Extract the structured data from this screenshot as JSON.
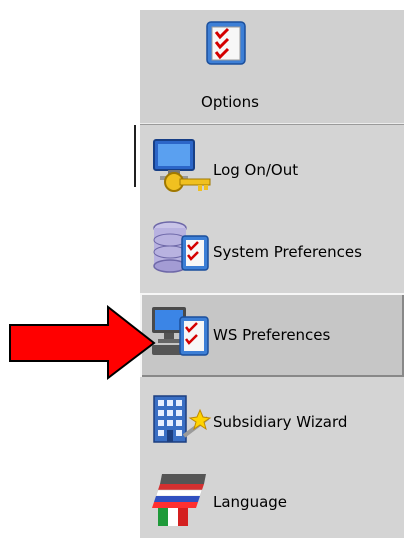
{
  "header": {
    "title": "Options",
    "icon": "checklist-icon"
  },
  "items": [
    {
      "label": "Log On/Out",
      "icon": "monitor-key-icon"
    },
    {
      "label": "System Preferences",
      "icon": "database-checklist-icon"
    },
    {
      "label": "WS Preferences",
      "icon": "computer-checklist-icon"
    },
    {
      "label": "Subsidiary Wizard",
      "icon": "building-wizard-icon"
    },
    {
      "label": "Language",
      "icon": "flags-icon"
    }
  ],
  "selected_index": 2,
  "colors": {
    "arrow": "#ff0000",
    "panel": "#d4d4d4",
    "check": "#d40000"
  }
}
